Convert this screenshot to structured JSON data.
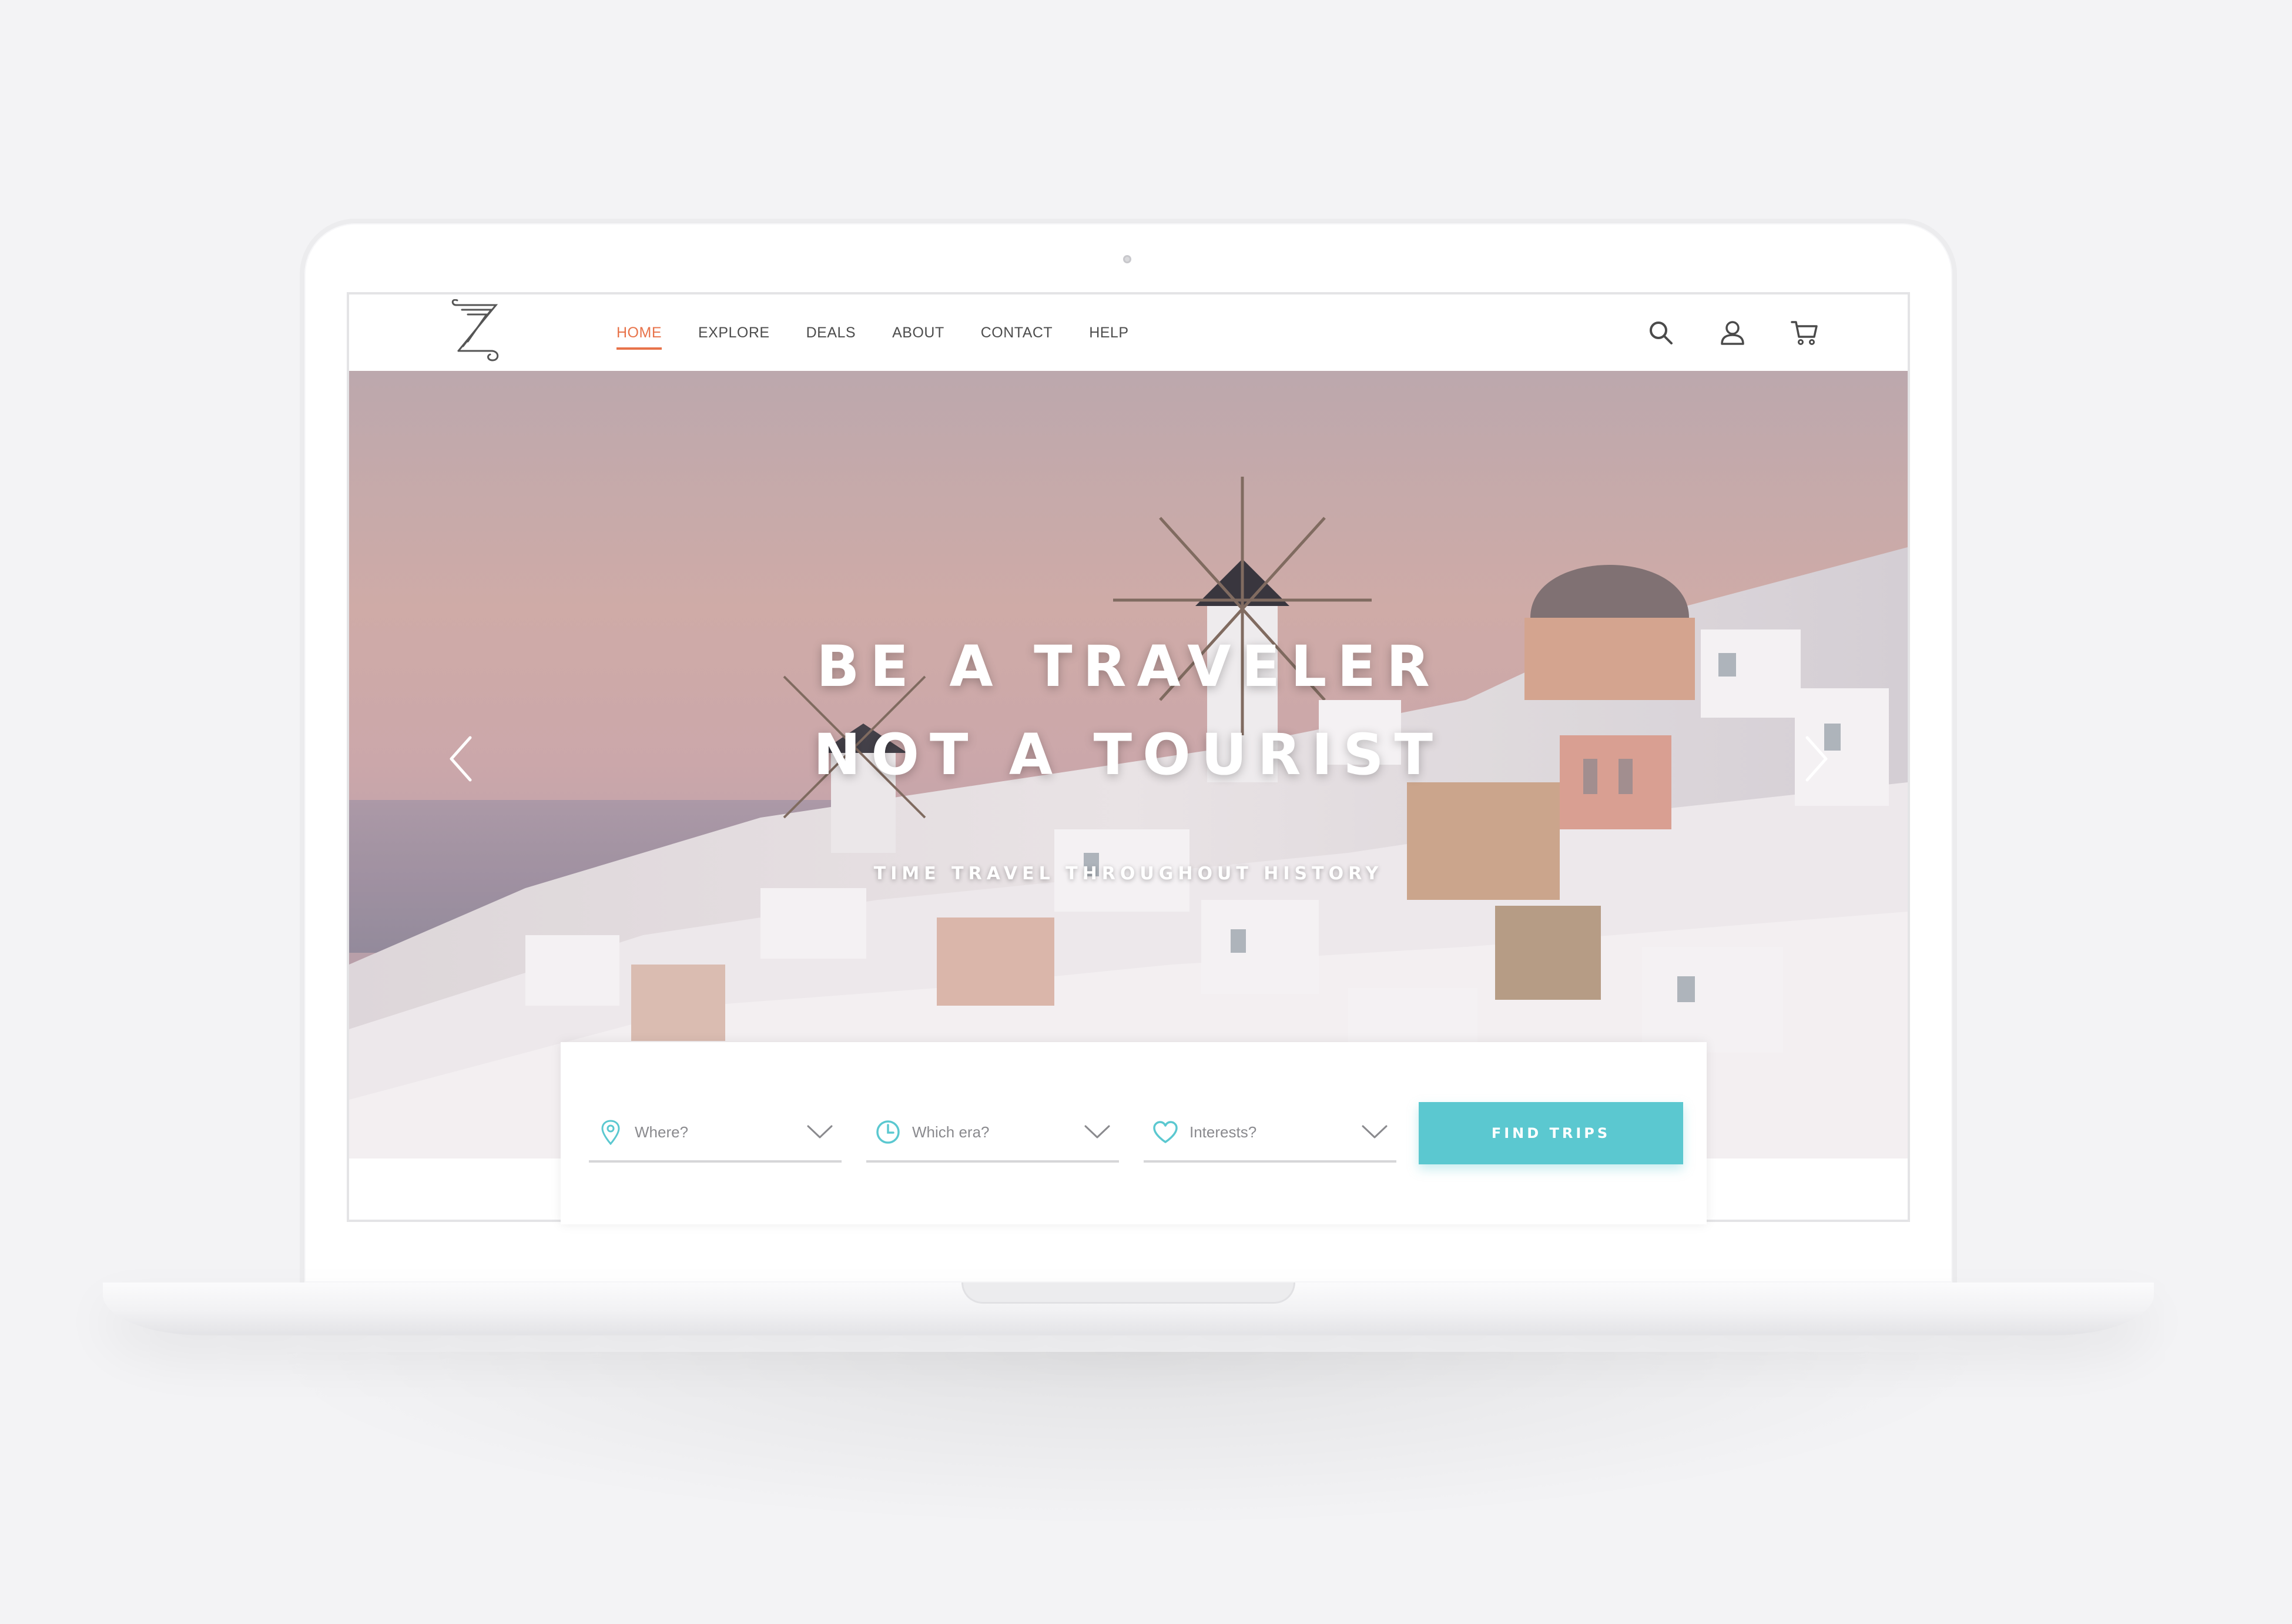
{
  "nav": {
    "items": [
      {
        "label": "HOME",
        "active": true
      },
      {
        "label": "EXPLORE",
        "active": false
      },
      {
        "label": "DEALS",
        "active": false
      },
      {
        "label": "ABOUT",
        "active": false
      },
      {
        "label": "CONTACT",
        "active": false
      },
      {
        "label": "HELP",
        "active": false
      }
    ],
    "icons": [
      "search-icon",
      "user-icon",
      "cart-icon"
    ]
  },
  "hero": {
    "title_line1": "BE A TRAVELER",
    "title_line2": "NOT A TOURIST",
    "subtitle": "TIME TRAVEL THROUGHOUT HISTORY"
  },
  "search": {
    "fields": [
      {
        "label": "Where?",
        "icon": "location-pin-icon"
      },
      {
        "label": "Which era?",
        "icon": "clock-icon"
      },
      {
        "label": "Interests?",
        "icon": "heart-icon"
      }
    ],
    "button_label": "FIND TRIPS"
  },
  "colors": {
    "accent": "#e8734a",
    "teal": "#5bc8d0",
    "background": "#f3f3f5"
  }
}
